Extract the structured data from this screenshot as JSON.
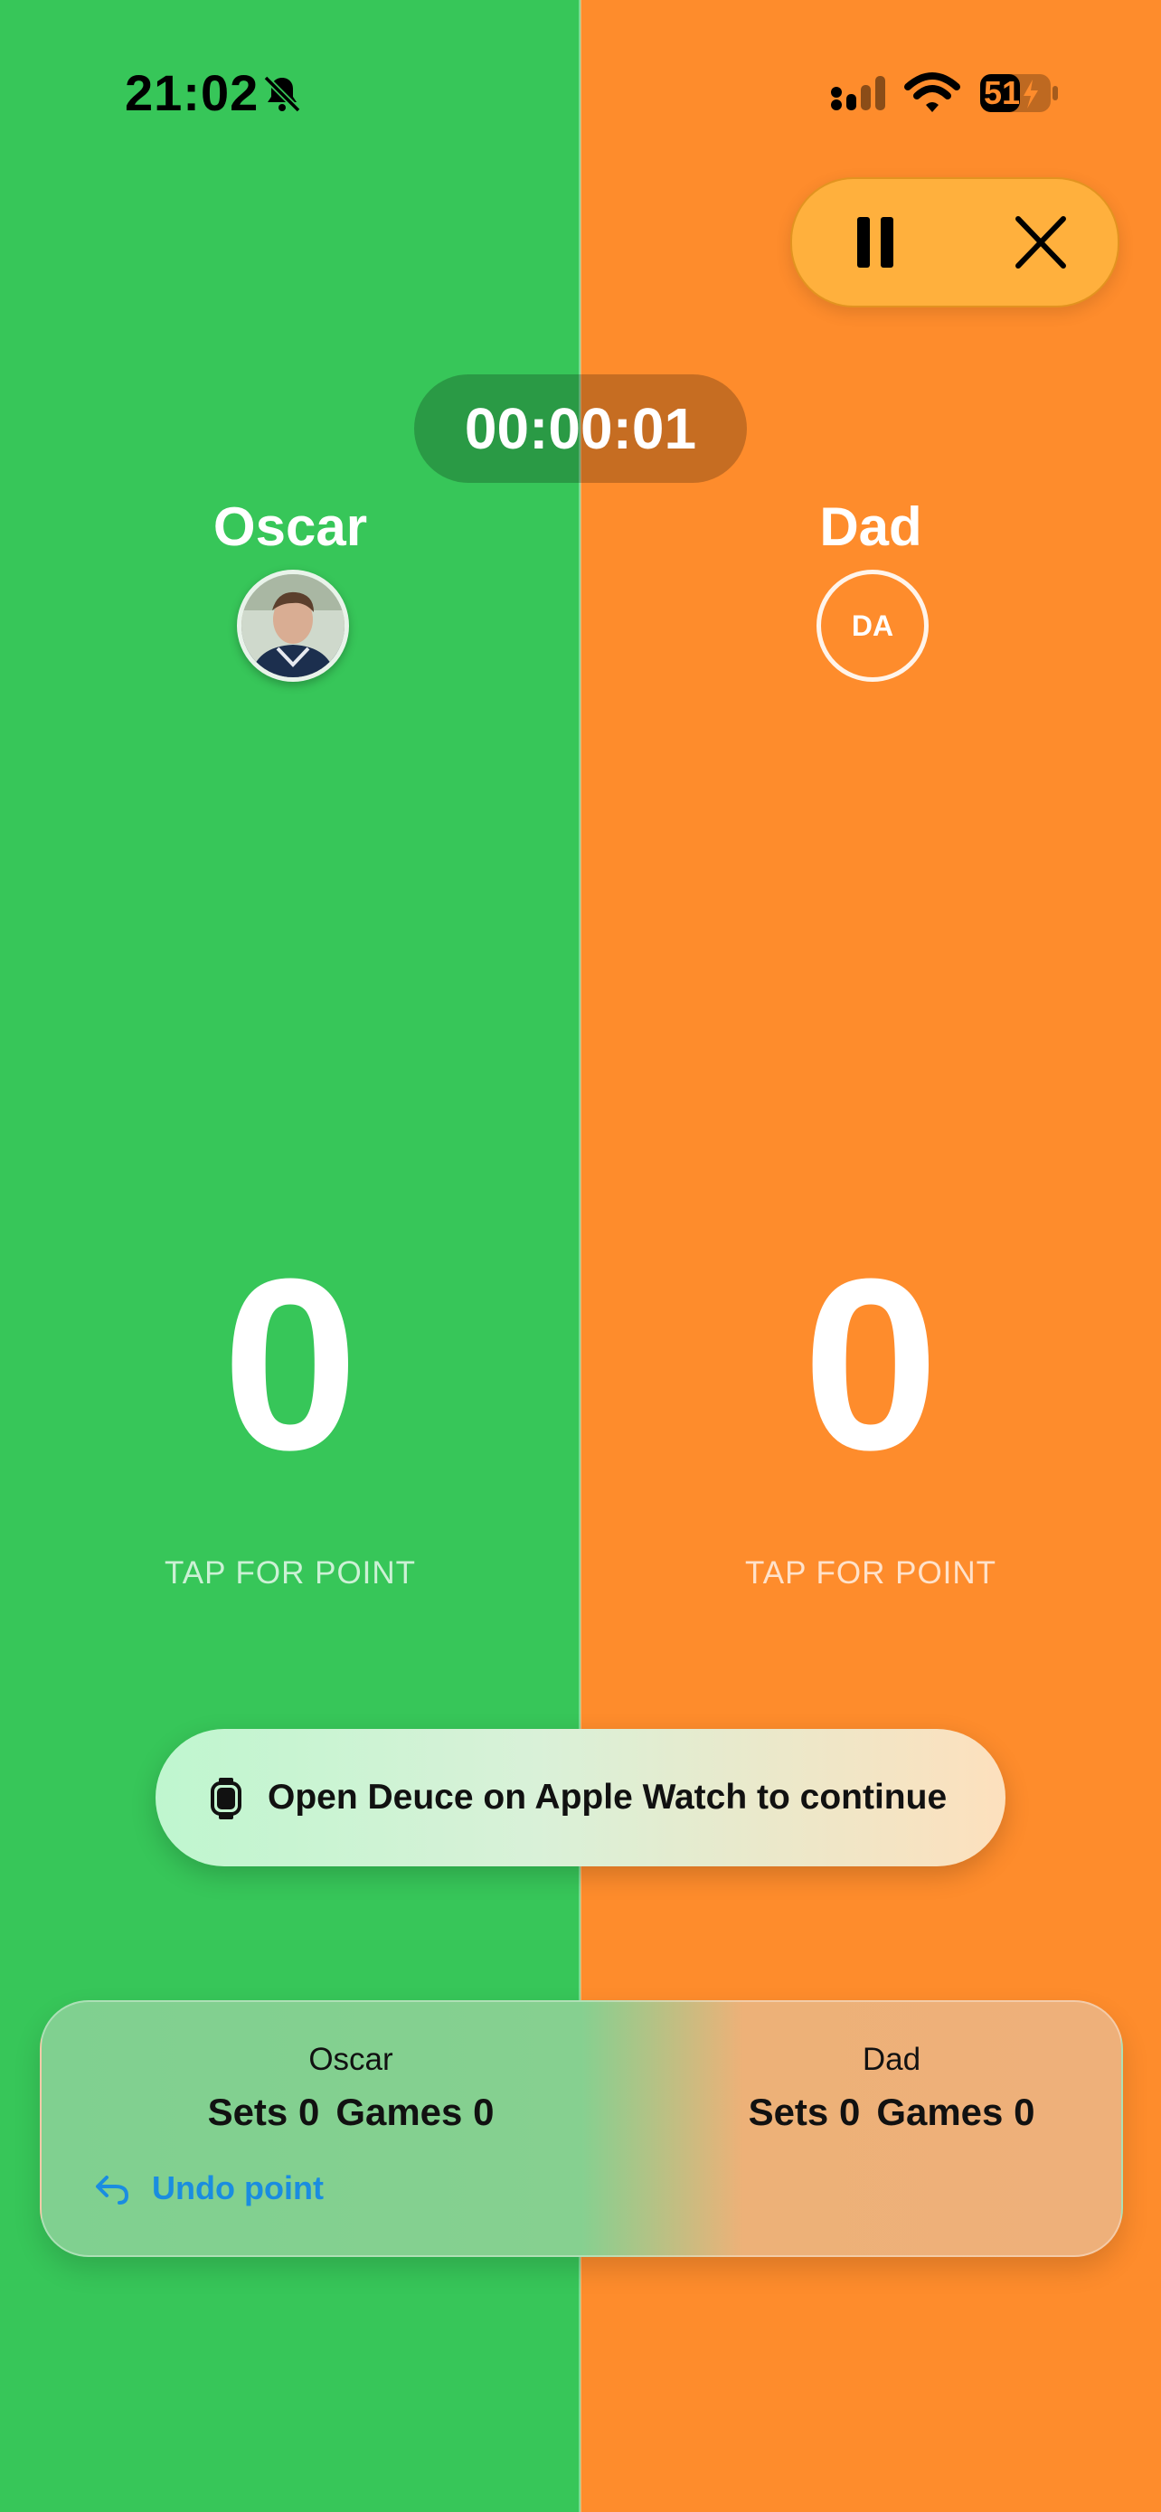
{
  "status_bar": {
    "time": "21:02",
    "battery": "51"
  },
  "timer": {
    "elapsed": "00:00:01"
  },
  "players": [
    {
      "name": "Oscar",
      "initials": "",
      "point_score": "0",
      "tap_label": "TAP FOR POINT"
    },
    {
      "name": "Dad",
      "initials": "DA",
      "point_score": "0",
      "tap_label": "TAP FOR POINT"
    }
  ],
  "watch_banner": {
    "text": "Open Deuce on Apple Watch to continue"
  },
  "scorecard": {
    "left": {
      "name": "Oscar",
      "sets": "Sets 0",
      "games": "Games 0"
    },
    "right": {
      "name": "Dad",
      "sets": "Sets 0",
      "games": "Games 0"
    },
    "undo_label": "Undo point"
  },
  "colors": {
    "left_bg": "#37c659",
    "right_bg": "#fe8c2c",
    "undo": "#1a8de0"
  }
}
